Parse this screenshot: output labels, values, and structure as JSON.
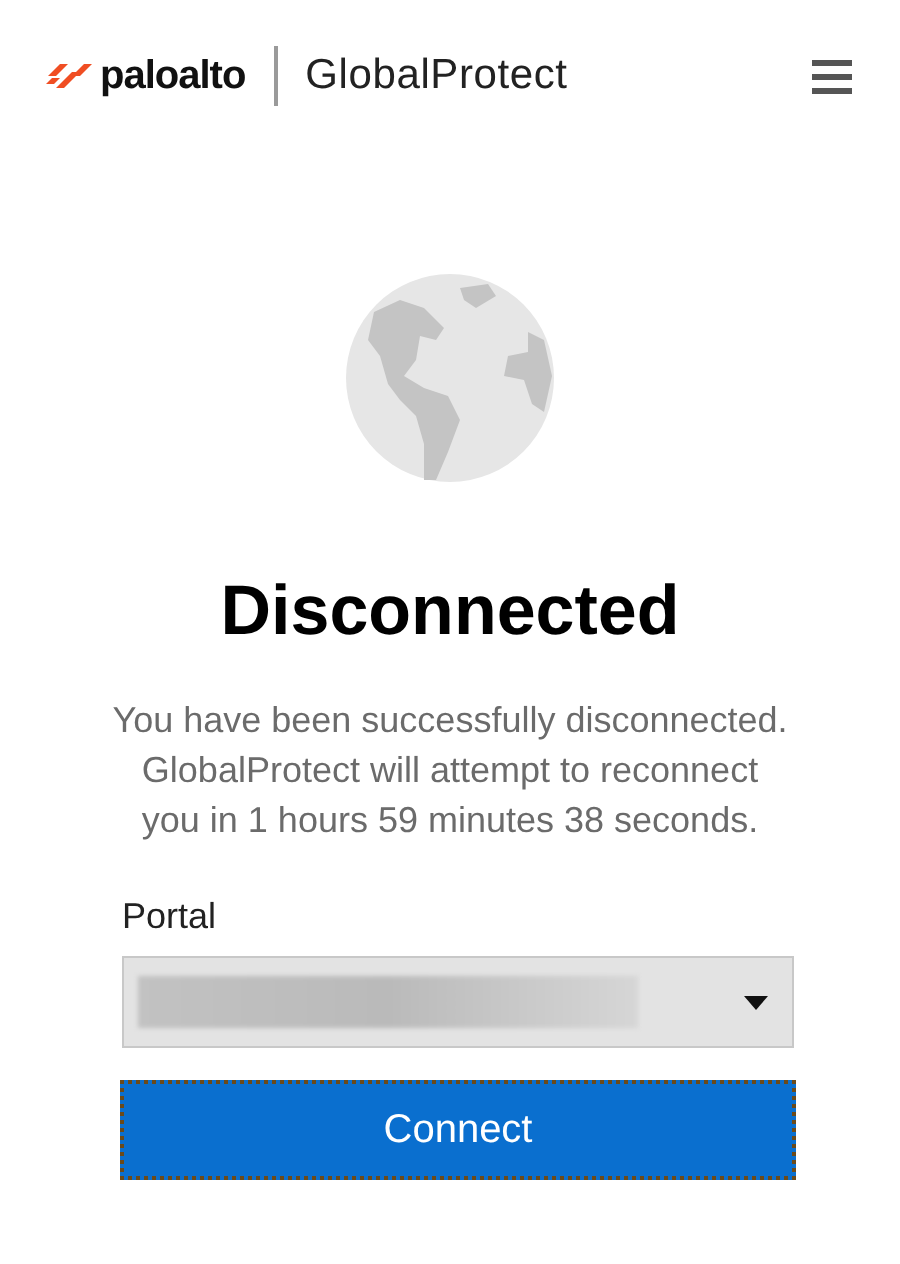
{
  "header": {
    "brand": "paloalto",
    "product": "GlobalProtect"
  },
  "status": {
    "title": "Disconnected",
    "message": "You have been successfully disconnected. GlobalProtect will attempt to reconnect you in 1 hours 59 minutes 38 seconds."
  },
  "portal": {
    "label": "Portal"
  },
  "buttons": [
    {
      "label": "Connect",
      "focused": true
    }
  ]
}
